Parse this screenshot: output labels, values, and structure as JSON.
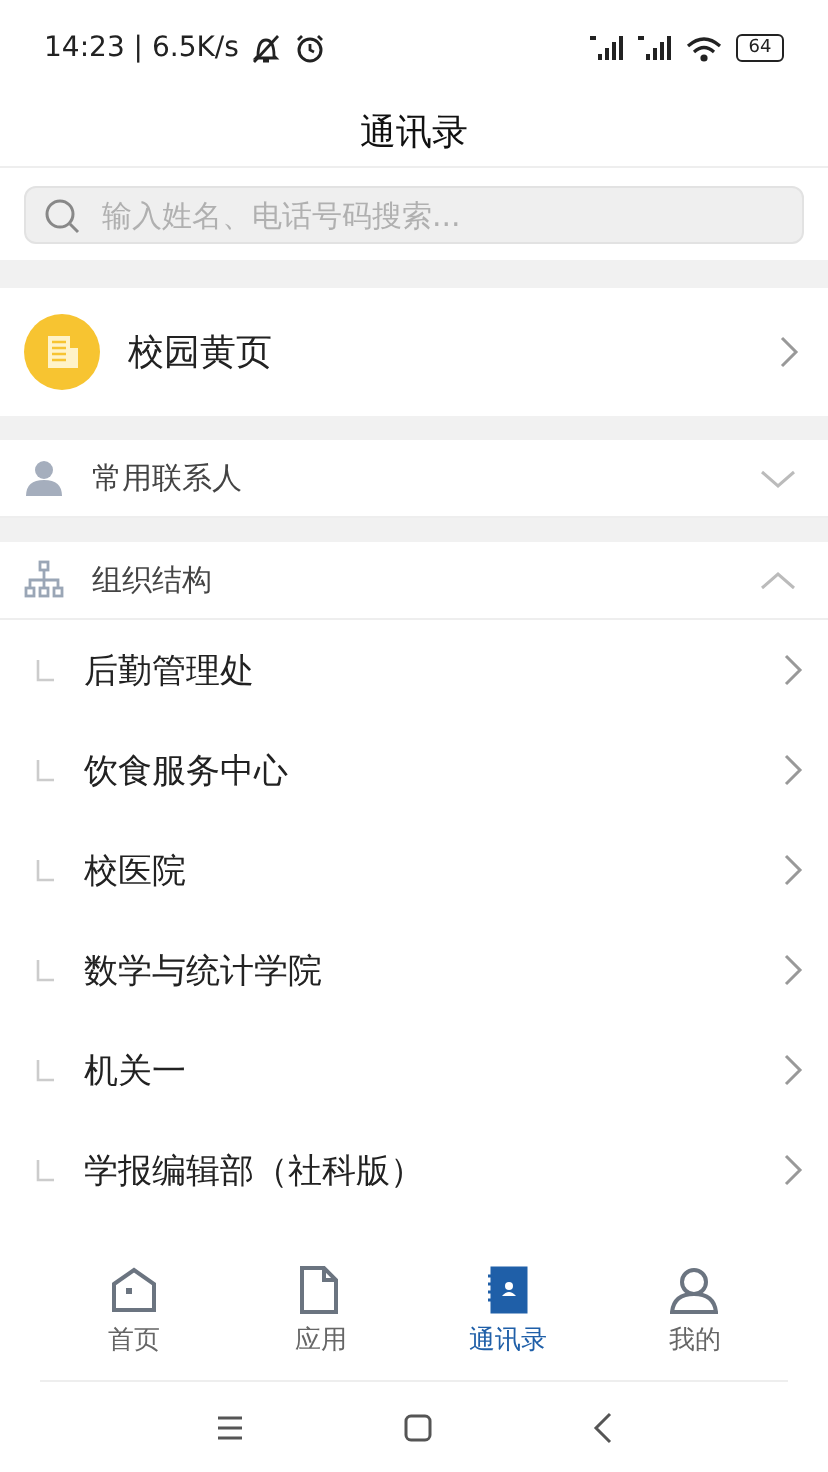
{
  "status_bar": {
    "time": "14:23 | 6.5K/s",
    "battery": "64"
  },
  "title": "通讯录",
  "search": {
    "placeholder": "输入姓名、电话号码搜索..."
  },
  "yellow_pages": {
    "label": "校园黄页"
  },
  "sections": [
    {
      "label": "常用联系人",
      "kind": "person",
      "expanded": false
    },
    {
      "label": "组织结构",
      "kind": "org",
      "expanded": true,
      "children": [
        {
          "label": "后勤管理处"
        },
        {
          "label": "饮食服务中心"
        },
        {
          "label": "校医院"
        },
        {
          "label": "数学与统计学院"
        },
        {
          "label": "机关一"
        },
        {
          "label": "学报编辑部（社科版）"
        }
      ]
    }
  ],
  "tabs": [
    {
      "label": "首页",
      "kind": "home",
      "selected": false
    },
    {
      "label": "应用",
      "kind": "apps",
      "selected": false
    },
    {
      "label": "通讯录",
      "kind": "contacts",
      "selected": true
    },
    {
      "label": "我的",
      "kind": "me",
      "selected": false
    }
  ]
}
